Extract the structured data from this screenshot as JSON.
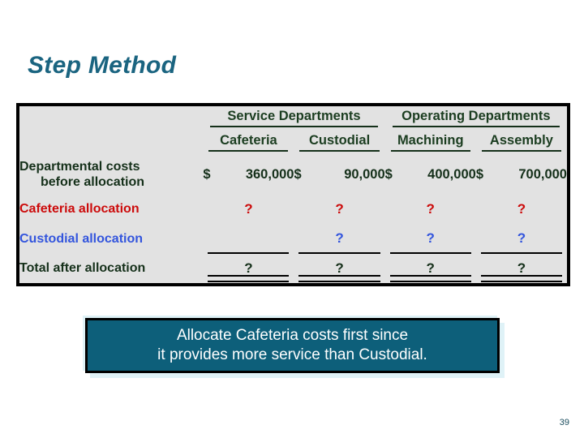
{
  "slide": {
    "title": "Step Method",
    "page_number": "39"
  },
  "table": {
    "group_headers": [
      {
        "label": "Service Departments",
        "span": 2
      },
      {
        "label": "Operating Departments",
        "span": 2
      }
    ],
    "column_headers": [
      "Cafeteria",
      "Custodial",
      "Machining",
      "Assembly"
    ],
    "rows": [
      {
        "label_line1": "Departmental costs",
        "label_line2": "before allocation",
        "label_color": "#15301a",
        "cells": [
          {
            "symbol": "$",
            "amount": "360,000"
          },
          {
            "symbol": "$",
            "amount": "90,000"
          },
          {
            "symbol": "$",
            "amount": "400,000"
          },
          {
            "symbol": "$",
            "amount": "700,000"
          }
        ]
      },
      {
        "label_line1": "Cafeteria allocation",
        "label_color": "#cc0b0b",
        "cells": [
          {
            "value": "?"
          },
          {
            "value": "?"
          },
          {
            "value": "?"
          },
          {
            "value": "?"
          }
        ]
      },
      {
        "label_line1": "Custodial allocation",
        "label_color": "#3355dd",
        "cells": [
          {
            "value": ""
          },
          {
            "value": "?"
          },
          {
            "value": "?"
          },
          {
            "value": "?"
          }
        ]
      },
      {
        "label_line1": "Total after allocation",
        "label_color": "#15301a",
        "cells": [
          {
            "value": "?"
          },
          {
            "value": "?"
          },
          {
            "value": "?"
          },
          {
            "value": "?"
          }
        ]
      }
    ]
  },
  "callout": {
    "text": "Allocate Cafeteria costs first since\nit provides more service than Custodial."
  },
  "colors": {
    "title": "#1a6480",
    "table_background": "#e2e2e2",
    "table_border": "#000000",
    "header_text": "#1b3d20",
    "cafeteria_red": "#cc0b0b",
    "custodial_blue": "#3355dd",
    "callout_background": "#0d5f7a",
    "callout_text": "#ffffff",
    "callout_glow": "#dff2f7"
  }
}
